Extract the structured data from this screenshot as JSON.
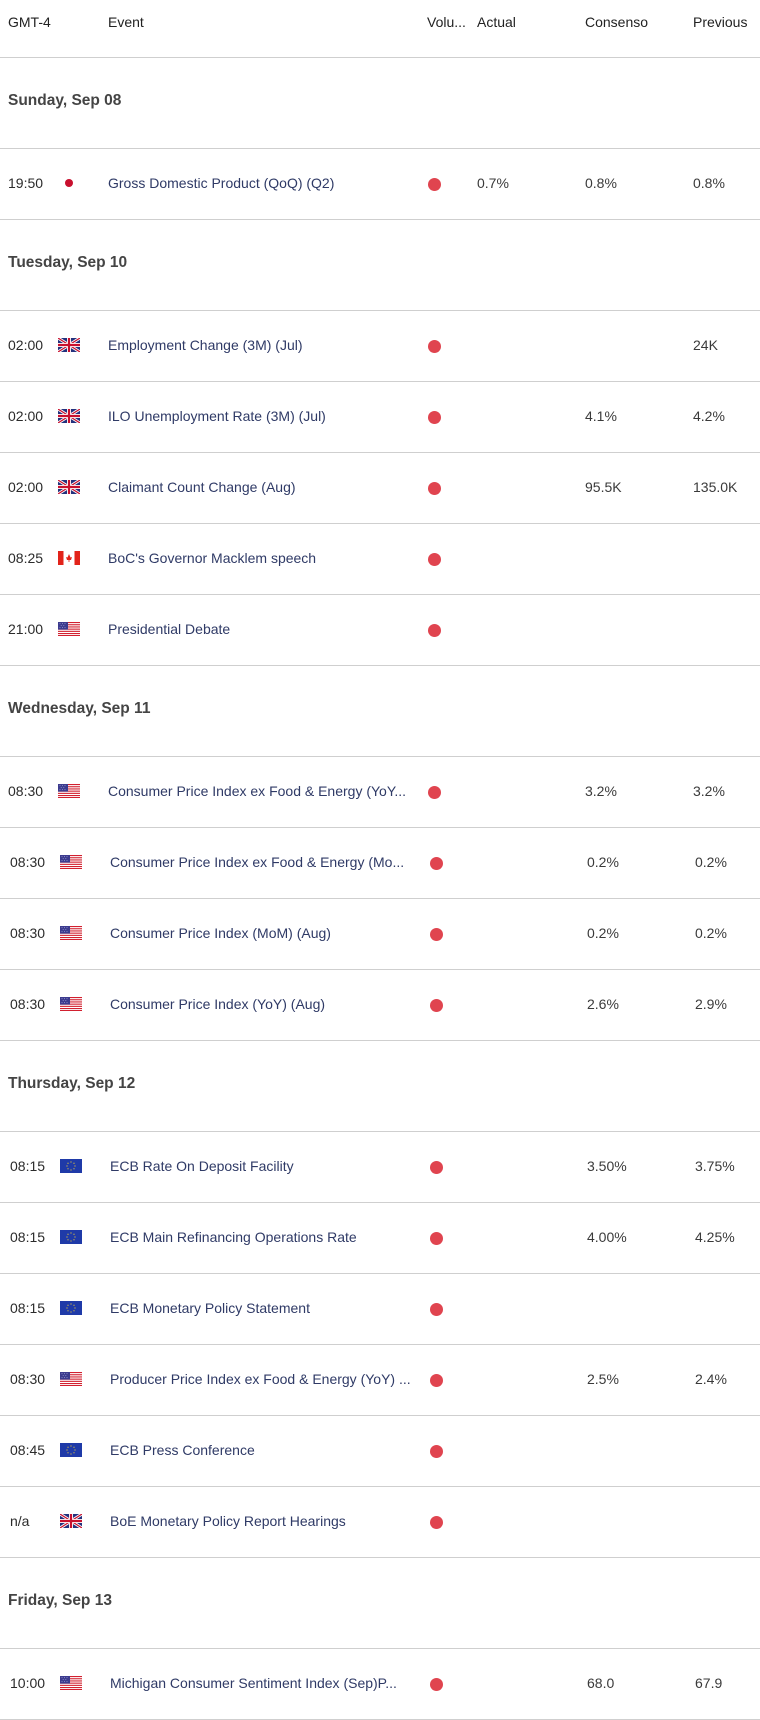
{
  "header": {
    "time": "GMT-4",
    "event": "Event",
    "volatility": "Volu...",
    "actual": "Actual",
    "consensus": "Consenso",
    "previous": "Previous"
  },
  "colors": {
    "volatility_high": "#e0444f",
    "divider": "#cfcfcf"
  },
  "days": [
    {
      "label": "Sunday, Sep 08",
      "events": [
        {
          "time": "19:50",
          "flag": "jp-flag-icon",
          "event": "Gross Domestic Product (QoQ) (Q2)",
          "volatility": "high",
          "actual": "0.7%",
          "consensus": "0.8%",
          "previous": "0.8%"
        }
      ]
    },
    {
      "label": "Tuesday, Sep 10",
      "events": [
        {
          "time": "02:00",
          "flag": "uk-flag-icon",
          "event": "Employment Change (3M) (Jul)",
          "volatility": "high",
          "actual": "",
          "consensus": "",
          "previous": "24K"
        },
        {
          "time": "02:00",
          "flag": "uk-flag-icon",
          "event": "ILO Unemployment Rate (3M) (Jul)",
          "volatility": "high",
          "actual": "",
          "consensus": "4.1%",
          "previous": "4.2%"
        },
        {
          "time": "02:00",
          "flag": "uk-flag-icon",
          "event": "Claimant Count Change (Aug)",
          "volatility": "high",
          "actual": "",
          "consensus": "95.5K",
          "previous": "135.0K"
        },
        {
          "time": "08:25",
          "flag": "ca-flag-icon",
          "event": "BoC's Governor Macklem speech",
          "volatility": "high",
          "actual": "",
          "consensus": "",
          "previous": ""
        },
        {
          "time": "21:00",
          "flag": "us-flag-icon",
          "event": "Presidential Debate",
          "volatility": "high",
          "actual": "",
          "consensus": "",
          "previous": ""
        }
      ]
    },
    {
      "label": "Wednesday, Sep 11",
      "events": [
        {
          "time": "08:30",
          "flag": "us-flag-icon",
          "event": "Consumer Price Index ex Food & Energy (YoY...",
          "volatility": "high",
          "actual": "",
          "consensus": "3.2%",
          "previous": "3.2%"
        },
        {
          "time": "08:30",
          "flag": "us-flag-icon",
          "event": "Consumer Price Index ex Food & Energy (Mo...",
          "volatility": "high",
          "actual": "",
          "consensus": "0.2%",
          "previous": "0.2%"
        },
        {
          "time": "08:30",
          "flag": "us-flag-icon",
          "event": "Consumer Price Index (MoM) (Aug)",
          "volatility": "high",
          "actual": "",
          "consensus": "0.2%",
          "previous": "0.2%"
        },
        {
          "time": "08:30",
          "flag": "us-flag-icon",
          "event": "Consumer Price Index (YoY) (Aug)",
          "volatility": "high",
          "actual": "",
          "consensus": "2.6%",
          "previous": "2.9%"
        }
      ]
    },
    {
      "label": "Thursday, Sep 12",
      "events": [
        {
          "time": "08:15",
          "flag": "eu-flag-icon",
          "event": "ECB Rate On Deposit Facility",
          "volatility": "high",
          "actual": "",
          "consensus": "3.50%",
          "previous": "3.75%"
        },
        {
          "time": "08:15",
          "flag": "eu-flag-icon",
          "event": "ECB Main Refinancing Operations Rate",
          "volatility": "high",
          "actual": "",
          "consensus": "4.00%",
          "previous": "4.25%"
        },
        {
          "time": "08:15",
          "flag": "eu-flag-icon",
          "event": "ECB Monetary Policy Statement",
          "volatility": "high",
          "actual": "",
          "consensus": "",
          "previous": ""
        },
        {
          "time": "08:30",
          "flag": "us-flag-icon",
          "event": "Producer Price Index ex Food & Energy (YoY) ...",
          "volatility": "high",
          "actual": "",
          "consensus": "2.5%",
          "previous": "2.4%"
        },
        {
          "time": "08:45",
          "flag": "eu-flag-icon",
          "event": "ECB Press Conference",
          "volatility": "high",
          "actual": "",
          "consensus": "",
          "previous": ""
        },
        {
          "time": "n/a",
          "flag": "uk-flag-icon",
          "event": "BoE Monetary Policy Report Hearings",
          "volatility": "high",
          "actual": "",
          "consensus": "",
          "previous": ""
        }
      ]
    },
    {
      "label": "Friday, Sep 13",
      "events": [
        {
          "time": "10:00",
          "flag": "us-flag-icon",
          "event": "Michigan Consumer Sentiment Index (Sep)P...",
          "volatility": "high",
          "actual": "",
          "consensus": "68.0",
          "previous": "67.9"
        }
      ]
    }
  ]
}
